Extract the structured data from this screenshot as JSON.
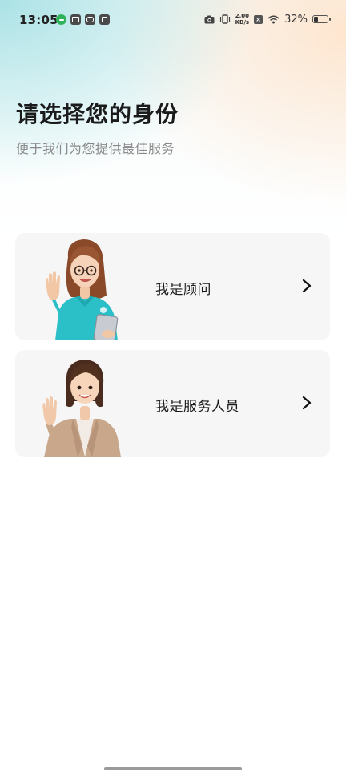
{
  "status_bar": {
    "time": "13:05",
    "net_speed_value": "2.00",
    "net_speed_unit": "KB/s",
    "battery": "32%"
  },
  "header": {
    "title": "请选择您的身份",
    "subtitle": "便于我们为您提供最佳服务"
  },
  "roles": [
    {
      "label": "我是顾问"
    },
    {
      "label": "我是服务人员"
    }
  ],
  "colors": {
    "card_bg": "#f6f6f6",
    "title": "#1b1b1b",
    "subtitle": "#8a8a8a",
    "consultant_shirt": "#2bbfc7",
    "staff_blazer": "#c9a78a"
  }
}
